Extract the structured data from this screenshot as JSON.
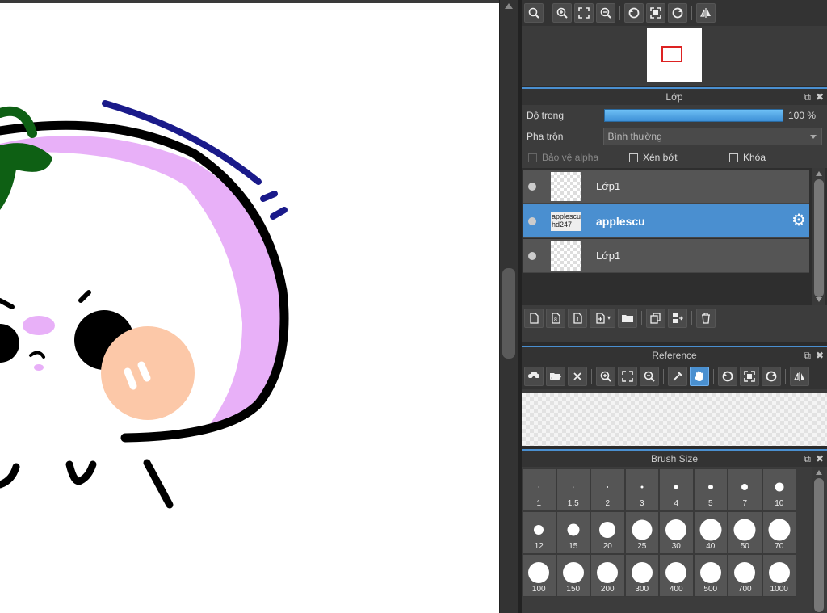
{
  "navigator": {
    "toolbar_icons": [
      "zoom-icon",
      "zoom-in-icon",
      "fit-icon",
      "zoom-out-icon",
      "rotate-left-icon",
      "reset-rotation-icon",
      "rotate-right-icon",
      "flip-icon"
    ]
  },
  "layer_panel": {
    "title": "Lớp",
    "opacity_label": "Độ trong",
    "opacity_value": "100 %",
    "opacity_percent": 100,
    "blend_label": "Pha trộn",
    "blend_value": "Bình thường",
    "protect_alpha_label": "Bảo vệ alpha",
    "clipping_label": "Xén bớt",
    "lock_label": "Khóa",
    "layers": [
      {
        "name": "Lớp1",
        "selected": false
      },
      {
        "name": "applescu",
        "thumb_text": "applescu hd247",
        "selected": true
      },
      {
        "name": "Lớp1",
        "selected": false
      }
    ],
    "toolbar_icons": [
      "new-layer-icon",
      "new-layer-8bit-icon",
      "new-layer-1bit-icon",
      "add-layer-menu-icon",
      "folder-icon",
      "duplicate-icon",
      "merge-icon",
      "delete-icon"
    ]
  },
  "reference_panel": {
    "title": "Reference",
    "toolbar_icons": [
      "upload-icon",
      "open-folder-icon",
      "close-icon",
      "zoom-in-icon",
      "fit-icon",
      "zoom-out-icon",
      "eyedropper-icon",
      "hand-icon",
      "rotate-left-icon",
      "reset-rotation-icon",
      "rotate-right-icon",
      "flip-icon"
    ]
  },
  "brush_size_panel": {
    "title": "Brush Size",
    "sizes": [
      "1",
      "1.5",
      "2",
      "3",
      "4",
      "5",
      "7",
      "10",
      "12",
      "15",
      "20",
      "25",
      "30",
      "40",
      "50",
      "70",
      "100",
      "150",
      "200",
      "300",
      "400",
      "500",
      "700",
      "1000"
    ]
  },
  "colors": {
    "accent": "#4a8fd0",
    "panel_bg": "#3c3c3c",
    "drawing_pink": "#e8b0f8",
    "drawing_cheek": "#fcc8a8",
    "drawing_leaf": "#0e6014",
    "drawing_blue": "#1a1a8a"
  }
}
